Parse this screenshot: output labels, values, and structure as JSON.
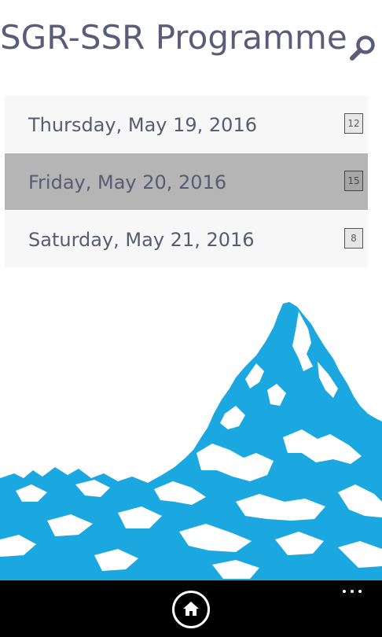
{
  "header": {
    "title": "SGR-SSR Programme",
    "search_icon": "search-icon"
  },
  "dates": [
    {
      "label": "Thursday, May 19, 2016",
      "count": "12",
      "selected": false
    },
    {
      "label": "Friday, May 20, 2016",
      "count": "15",
      "selected": true
    },
    {
      "label": "Saturday, May 21, 2016",
      "count": "8",
      "selected": false
    }
  ],
  "illustration": {
    "icon": "mountain-illustration",
    "color": "#1ba8e0"
  },
  "app_bar": {
    "home_icon": "home-icon",
    "more_icon": "ellipsis-icon"
  },
  "colors": {
    "title": "#5a5d79",
    "selected_row": "#b5b5b5",
    "row": "#f7f7f7",
    "accent": "#1ba8e0"
  }
}
